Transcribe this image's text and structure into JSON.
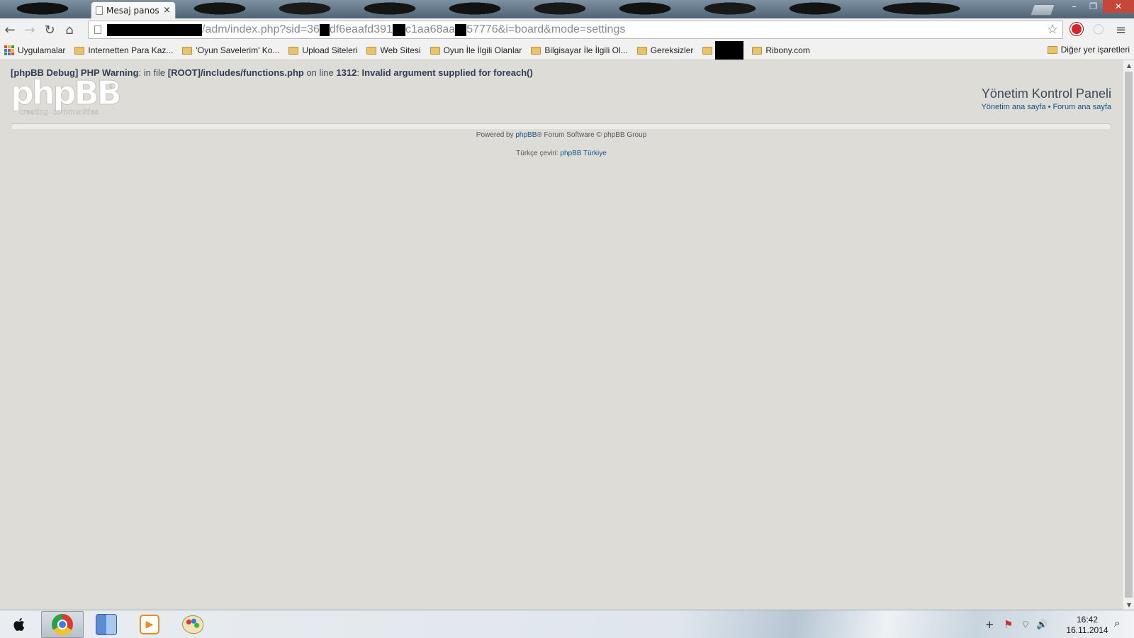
{
  "browser": {
    "tab_title": "Mesaj panos",
    "tab_close": "×",
    "window_buttons": {
      "minimize": "–",
      "restore": "❐",
      "close": "✕"
    },
    "url": {
      "segments": [
        "/adm/index.php?sid=36",
        "df6eaafd391",
        "c1aa68aa",
        "57776&i=board&mode=settings"
      ]
    },
    "nav": {
      "back": "←",
      "forward": "→",
      "reload": "↻",
      "home": "⌂"
    },
    "star": "☆",
    "menu": "≡"
  },
  "bookmarks": {
    "apps_label": "Uygulamalar",
    "items": [
      "Internetten Para Kaz...",
      "'Oyun Savelerim' Ko...",
      "Upload Siteleri",
      "Web Sitesi",
      "Oyun İle İlgili Olanlar",
      "Bilgisayar İle İlgili Ol...",
      "Gereksizler"
    ],
    "after_redacted": "Ribony.com",
    "other": "Diğer yer işaretleri"
  },
  "page": {
    "debug": {
      "prefix": "[phpBB Debug] PHP Warning",
      "in_file": ": in file ",
      "file": "[ROOT]/includes/functions.php",
      "on_line": " on line ",
      "line": "1312",
      "colon": ": ",
      "message": "Invalid argument supplied for foreach()"
    },
    "logo": {
      "text": "phpBB",
      "tagline": "creating  communities",
      "reg": "®"
    },
    "acp_title": "Yönetim Kontrol Paneli",
    "links": {
      "admin_index": "Yönetim ana sayfa",
      "separator": "•",
      "forum_index": "Forum ana sayfa"
    },
    "powered": {
      "before": "Powered by ",
      "link": "phpBB",
      "after": "® Forum Software © phpBB Group"
    },
    "translation": {
      "before": "Türkçe çeviri: ",
      "link": "phpBB Türkiye"
    }
  },
  "taskbar": {
    "start": "",
    "time": "16:42",
    "date": "16.11.2014",
    "tray": {
      "plus": "+",
      "flag": "⚑",
      "wifi": "⌔",
      "volume": "🔊",
      "search": "⌕"
    }
  },
  "colors": {
    "page_bg": "#dedcd6",
    "link": "#105289",
    "debug_text": "#3d4a5c",
    "close_red": "#c7463a"
  }
}
